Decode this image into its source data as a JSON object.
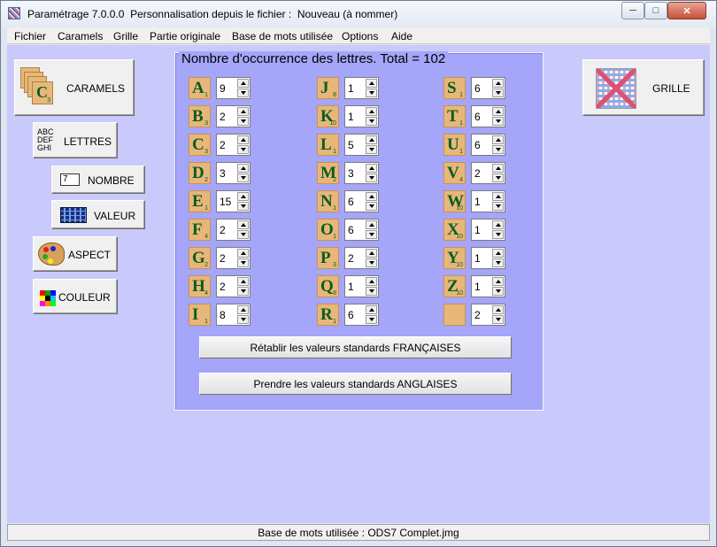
{
  "window": {
    "title": "Paramétrage 7.0.0.0  Personnalisation depuis le fichier :  Nouveau (à nommer)",
    "controls": {
      "minimize": "─",
      "maximize": "□",
      "close": "✕"
    }
  },
  "menu": [
    "Fichier",
    "Caramels",
    "Grille",
    "Partie originale",
    "Base de mots utilisée",
    "Options",
    "Aide"
  ],
  "left_buttons": {
    "caramels": "CARAMELS",
    "lettres": "LETTRES",
    "lettres_icon_text": [
      "ABC",
      "DEF",
      "GHI"
    ],
    "nombre": "NOMBRE",
    "nombre_icon_digit": "7",
    "valeur": "VALEUR",
    "aspect": "ASPECT",
    "couleur": "COULEUR",
    "caramels_tile": {
      "letter": "C",
      "points": "3"
    }
  },
  "grille_button": "GRILLE",
  "panel": {
    "title": "Nombre d'occurrence des lettres. Total = 102",
    "letters": [
      {
        "letter": "A",
        "points": "1",
        "count": "9"
      },
      {
        "letter": "B",
        "points": "3",
        "count": "2"
      },
      {
        "letter": "C",
        "points": "3",
        "count": "2"
      },
      {
        "letter": "D",
        "points": "2",
        "count": "3"
      },
      {
        "letter": "E",
        "points": "1",
        "count": "15"
      },
      {
        "letter": "F",
        "points": "4",
        "count": "2"
      },
      {
        "letter": "G",
        "points": "2",
        "count": "2"
      },
      {
        "letter": "H",
        "points": "4",
        "count": "2"
      },
      {
        "letter": "I",
        "points": "1",
        "count": "8"
      },
      {
        "letter": "J",
        "points": "8",
        "count": "1"
      },
      {
        "letter": "K",
        "points": "10",
        "count": "1"
      },
      {
        "letter": "L",
        "points": "1",
        "count": "5"
      },
      {
        "letter": "M",
        "points": "2",
        "count": "3"
      },
      {
        "letter": "N",
        "points": "1",
        "count": "6"
      },
      {
        "letter": "O",
        "points": "1",
        "count": "6"
      },
      {
        "letter": "P",
        "points": "3",
        "count": "2"
      },
      {
        "letter": "Q",
        "points": "8",
        "count": "1"
      },
      {
        "letter": "R",
        "points": "1",
        "count": "6"
      },
      {
        "letter": "S",
        "points": "1",
        "count": "6"
      },
      {
        "letter": "T",
        "points": "1",
        "count": "6"
      },
      {
        "letter": "U",
        "points": "1",
        "count": "6"
      },
      {
        "letter": "V",
        "points": "4",
        "count": "2"
      },
      {
        "letter": "W",
        "points": "10",
        "count": "1"
      },
      {
        "letter": "X",
        "points": "10",
        "count": "1"
      },
      {
        "letter": "Y",
        "points": "10",
        "count": "1"
      },
      {
        "letter": "Z",
        "points": "10",
        "count": "1"
      },
      {
        "letter": "",
        "points": "",
        "count": "2"
      }
    ],
    "btn_french": "Rétablir les valeurs standards FRANÇAISES",
    "btn_english": "Prendre les valeurs standards ANGLAISES"
  },
  "status": "Base de mots utilisée : ODS7 Complet.jmg",
  "colors": {
    "client_bg": "#c9c9fb",
    "panel_bg": "#a5a5f9",
    "tile": "#e7b779",
    "tile_text": "#0a5d1e"
  }
}
